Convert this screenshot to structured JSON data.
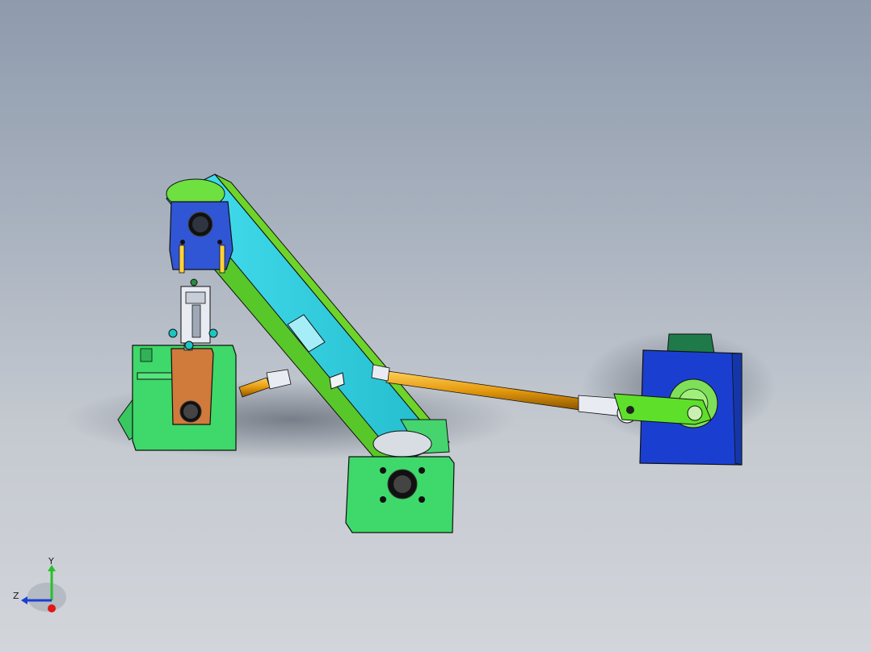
{
  "viewport": {
    "background_top": "#8e9bad",
    "background_bottom": "#d2d5da"
  },
  "model": {
    "parts": [
      {
        "name": "main-arm",
        "color": "#2ecfe0",
        "edge_color": "#6ed42a"
      },
      {
        "name": "top-pulley-block",
        "color": "#3056d6"
      },
      {
        "name": "left-support-bracket",
        "color": "#3fd86a"
      },
      {
        "name": "bottom-pivot-bracket",
        "color": "#3fd86a"
      },
      {
        "name": "copper-clamp-plate",
        "color": "#d07a3c"
      },
      {
        "name": "orange-connecting-rod",
        "color": "#e59a0e"
      },
      {
        "name": "blue-motor-block",
        "color": "#1a3fd0"
      },
      {
        "name": "green-crank-arm",
        "color": "#5ee02a"
      },
      {
        "name": "pneumatic-cylinder",
        "color": "#e8ecf2"
      }
    ]
  },
  "triad": {
    "y_label": "Y",
    "z_label": "Z",
    "y_color": "#27c12b",
    "z_color": "#1b3ed3",
    "x_color": "#e01818"
  }
}
